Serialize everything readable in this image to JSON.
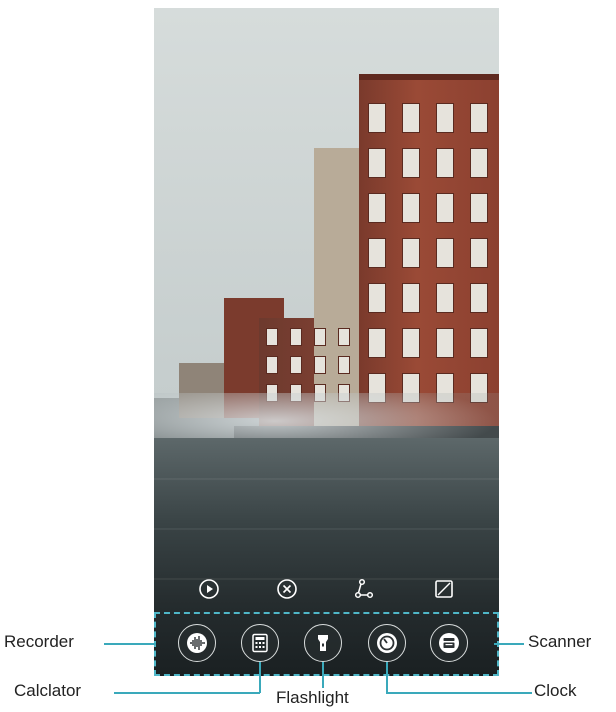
{
  "toolbar": {
    "icons": [
      "play-icon",
      "close-circle-icon",
      "share-icon",
      "edit-image-icon"
    ]
  },
  "shortcuts": [
    {
      "name": "recorder",
      "icon": "waveform-icon"
    },
    {
      "name": "calculator",
      "icon": "calculator-icon"
    },
    {
      "name": "flashlight",
      "icon": "flashlight-icon"
    },
    {
      "name": "clock",
      "icon": "timer-icon"
    },
    {
      "name": "scanner",
      "icon": "scanner-icon"
    }
  ],
  "labels": {
    "recorder": "Recorder",
    "calculator": "Calclator",
    "flashlight": "Flashlight",
    "clock": "Clock",
    "scanner": "Scanner"
  },
  "colors": {
    "accent": "#3aa9bb"
  }
}
